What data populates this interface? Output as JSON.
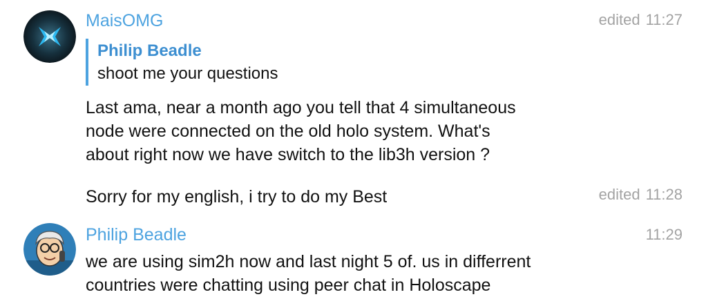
{
  "messages": [
    {
      "sender": "MaisOMG",
      "status": "edited",
      "time": "11:27",
      "reply": {
        "name": "Philip Beadle",
        "text": "shoot me your questions"
      },
      "lines": [
        "Last ama, near a month ago you tell that 4 simultaneous",
        "node were connected on the old holo system. What's",
        "about right now we have switch to the lib3h version ?"
      ]
    },
    {
      "text": "Sorry for my english, i try to do my Best",
      "status": "edited",
      "time": "11:28"
    },
    {
      "sender": "Philip Beadle",
      "time": "11:29",
      "lines": [
        "we are using sim2h now and last night 5 of. us in differrent",
        "countries were chatting using peer chat in Holoscape"
      ]
    }
  ]
}
